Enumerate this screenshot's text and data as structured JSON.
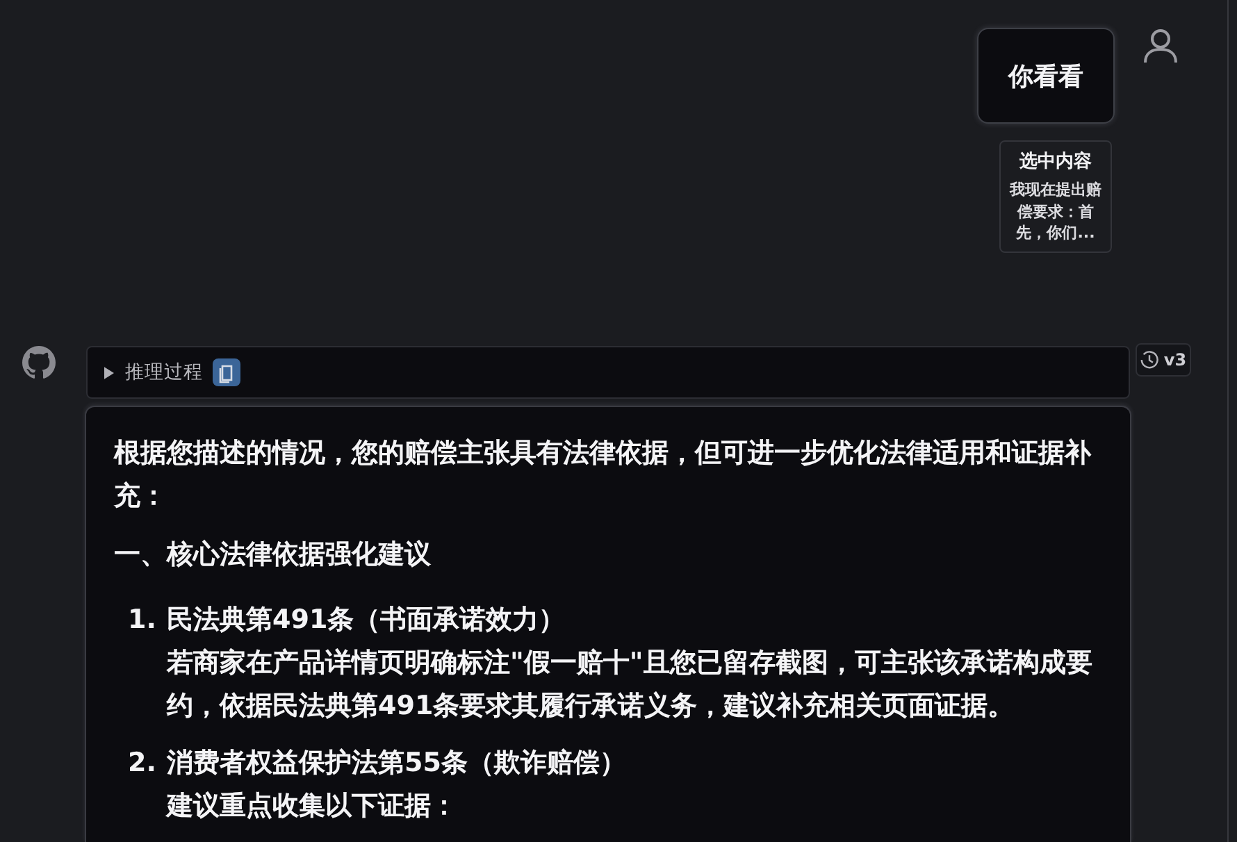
{
  "user_message": {
    "text": "你看看"
  },
  "selection": {
    "title": "选中内容",
    "text": "我现在提出赔偿要求：首先，你们..."
  },
  "reasoning": {
    "label": "推理过程",
    "expanded": false
  },
  "version": {
    "label": "v3"
  },
  "answer": {
    "intro": "根据您描述的情况，您的赔偿主张具有法律依据，但可进一步优化法律适用和证据补充：",
    "heading": "一、核心法律依据强化建议",
    "items": [
      {
        "number": "1.",
        "title": "民法典第491条（书面承诺效力）",
        "body": "若商家在产品详情页明确标注\"假一赔十\"且您已留存截图，可主张该承诺构成要约，依据民法典第491条要求其履行承诺义务，建议补充相关页面证据。"
      },
      {
        "number": "2.",
        "title": "消费者权益保护法第55条（欺诈赔偿）",
        "body": "建议重点收集以下证据："
      }
    ]
  }
}
